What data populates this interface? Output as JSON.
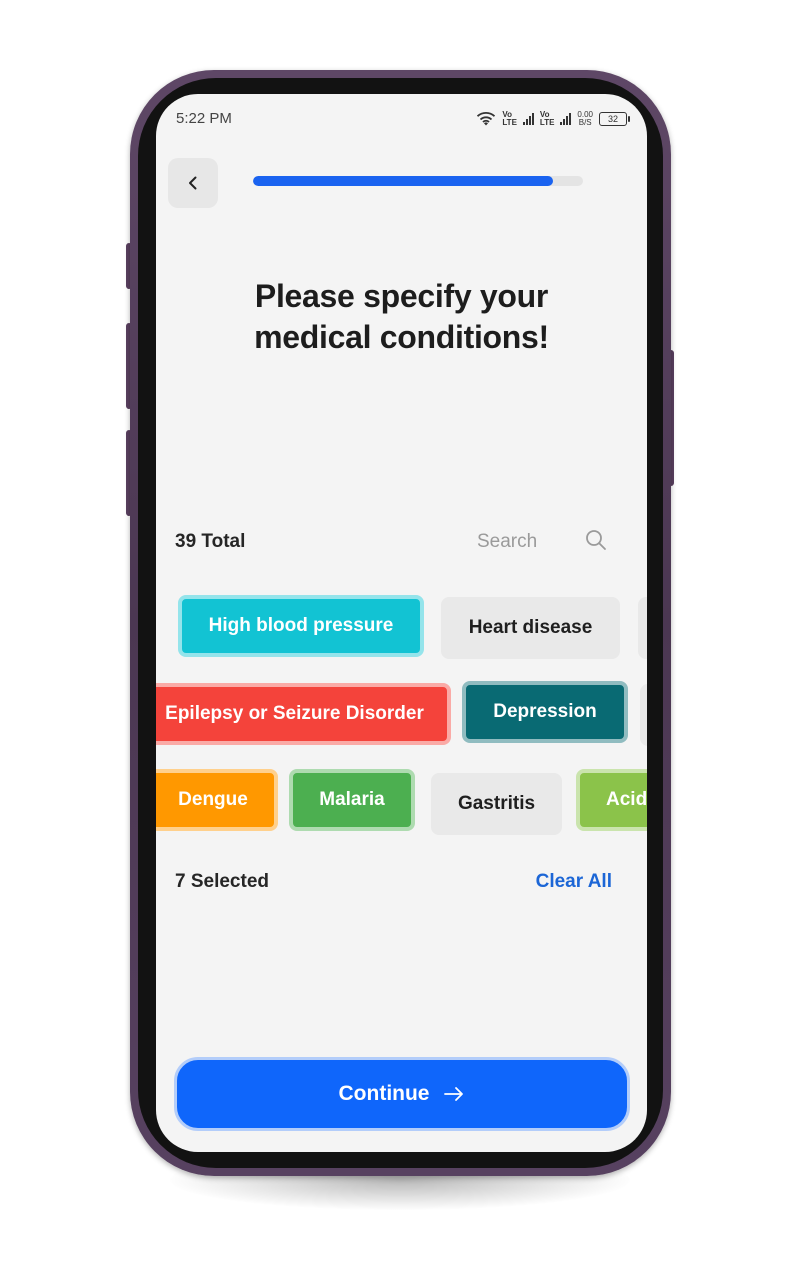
{
  "status_bar": {
    "time": "5:22 PM",
    "network_label_1": "Vo",
    "network_sub_1": "LTE",
    "network_label_2": "Vo",
    "network_sub_2": "LTE",
    "speed_value": "0.00",
    "speed_unit": "B/S",
    "battery_level": "32"
  },
  "header": {
    "back_icon": "chevron-left-icon",
    "progress_fraction": 0.91
  },
  "heading": {
    "line1": "Please specify your",
    "line2": "medical conditions!"
  },
  "list_header": {
    "total_label": "39 Total",
    "search_placeholder": "Search",
    "search_icon": "search-icon"
  },
  "conditions": {
    "row1": [
      {
        "label": "High blood pressure",
        "selected": true,
        "color": "#12c3d3"
      },
      {
        "label": "Heart disease",
        "selected": false
      }
    ],
    "row2": [
      {
        "label": "Epilepsy or Seizure Disorder",
        "selected": true,
        "color": "#f4433b"
      },
      {
        "label": "Depression",
        "selected": true,
        "color": "#096a73"
      }
    ],
    "row3": [
      {
        "label": "Dengue",
        "selected": true,
        "color": "#ff9800"
      },
      {
        "label": "Malaria",
        "selected": true,
        "color": "#4caf50"
      },
      {
        "label": "Gastritis",
        "selected": false
      },
      {
        "label": "Acid",
        "selected": true,
        "color": "#8bc34a"
      }
    ]
  },
  "selection": {
    "selected_label": "7 Selected",
    "clear_all_label": "Clear All"
  },
  "footer": {
    "continue_label": "Continue",
    "continue_icon": "arrow-right-icon"
  }
}
